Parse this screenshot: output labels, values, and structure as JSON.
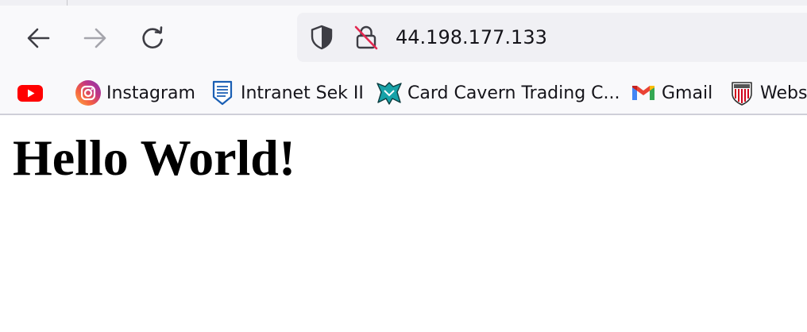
{
  "toolbar": {
    "back_icon": "arrow-left-icon",
    "forward_icon": "arrow-right-icon",
    "reload_icon": "reload-icon"
  },
  "urlbar": {
    "tracking_icon": "shield-icon",
    "security_icon": "insecure-lock-icon",
    "url": "44.198.177.133"
  },
  "bookmarks": [
    {
      "icon": "youtube-icon",
      "label": ""
    },
    {
      "icon": "instagram-icon",
      "label": "Instagram"
    },
    {
      "icon": "intranet-icon",
      "label": "Intranet Sek II"
    },
    {
      "icon": "card-cavern-icon",
      "label": "Card Cavern Trading C..."
    },
    {
      "icon": "gmail-icon",
      "label": "Gmail"
    },
    {
      "icon": "athletic-club-crest-icon",
      "label": "Webs"
    }
  ],
  "page": {
    "heading": "Hello World!"
  },
  "colors": {
    "toolbar_bg": "#f9f9fb",
    "urlbar_bg": "#f0f0f4",
    "youtube_red": "#ff0000",
    "insecure_strike": "#e22850",
    "intranet_blue": "#1a5fb4",
    "card_cavern_teal": "#17a2a8"
  }
}
